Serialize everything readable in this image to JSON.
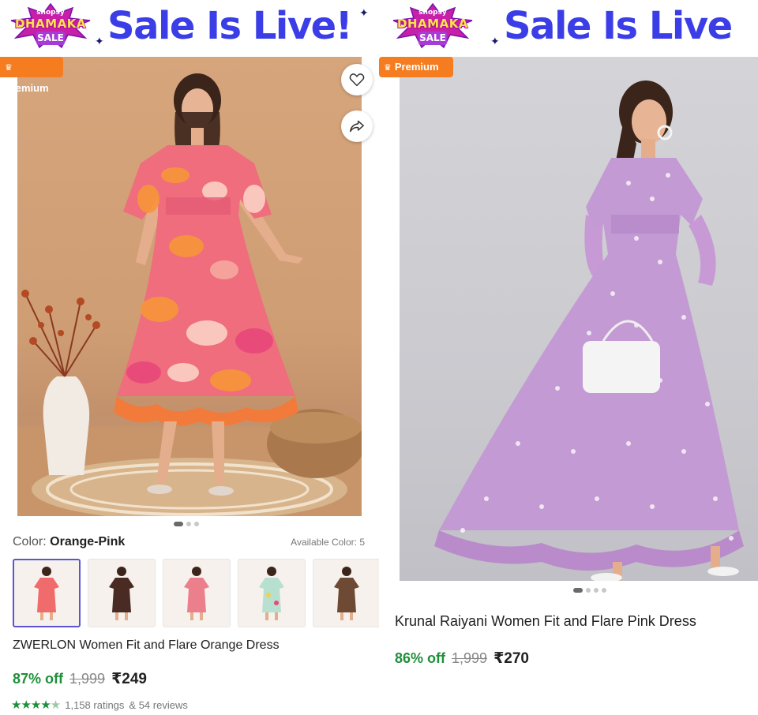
{
  "left": {
    "banner": {
      "logo": {
        "top": "shopsy",
        "middle": "DHAMAKA",
        "bottom": "SALE"
      },
      "headline": "Sale Is Live!"
    },
    "badge": {
      "label": "Premium",
      "icon": "crown-icon"
    },
    "actions": {
      "wishlist_icon": "heart-icon",
      "share_icon": "share-icon"
    },
    "pager": {
      "count": 3,
      "active": 0
    },
    "color": {
      "label": "Color:",
      "value": "Orange-Pink",
      "available": "Available Color: 5"
    },
    "swatches": [
      {
        "name": "orange-pink",
        "color": "#f06b6b",
        "selected": true
      },
      {
        "name": "dark-brown",
        "color": "#4a2b24",
        "selected": false
      },
      {
        "name": "pink",
        "color": "#ec7f8c",
        "selected": false
      },
      {
        "name": "mint-floral",
        "color": "#b8e0d0",
        "selected": false
      },
      {
        "name": "brown-floral",
        "color": "#6e4a35",
        "selected": false
      }
    ],
    "title": "ZWERLON Women Fit and Flare Orange Dress",
    "price": {
      "discount": "87% off",
      "mrp": "1,999",
      "sale": "₹249"
    },
    "rating": {
      "stars": 4.5,
      "ratings": "1,158 ratings",
      "reviews": "& 54 reviews"
    }
  },
  "right": {
    "banner": {
      "logo": {
        "top": "shopsy",
        "middle": "DHAMAKA",
        "bottom": "SALE"
      },
      "headline": "Sale Is Live"
    },
    "badge": {
      "label": "Premium",
      "icon": "crown-icon"
    },
    "pager": {
      "count": 4,
      "active": 0
    },
    "title": "Krunal Raiyani Women Fit and Flare Pink Dress",
    "price": {
      "discount": "86% off",
      "mrp": "1,999",
      "sale": "₹270"
    }
  },
  "colors": {
    "brand_blue": "#3b3ee6",
    "premium_orange": "#f57c1f",
    "discount_green": "#1f8f3a",
    "selected_swatch": "#5a55d6"
  }
}
